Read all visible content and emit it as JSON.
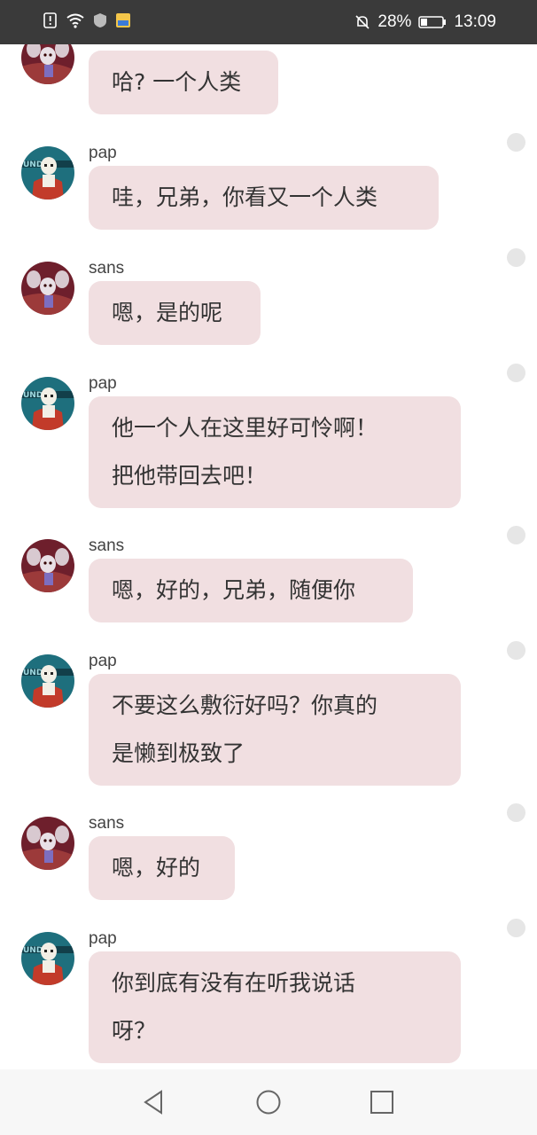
{
  "status_bar": {
    "battery": "28%",
    "time": "13:09",
    "icons": [
      "alert-icon",
      "wifi-icon",
      "shield-icon",
      "app-badge-icon",
      "mute-bell-icon",
      "battery-icon"
    ]
  },
  "messages": [
    {
      "sender": "",
      "avatar": "sans",
      "lines": [
        "哈? 一个人类"
      ]
    },
    {
      "sender": "pap",
      "avatar": "pap",
      "lines": [
        "哇，兄弟，你看又一个人类"
      ]
    },
    {
      "sender": "sans",
      "avatar": "sans",
      "lines": [
        "嗯，是的呢"
      ]
    },
    {
      "sender": "pap",
      "avatar": "pap",
      "lines": [
        "他一个人在这里好可怜啊！",
        "把他带回去吧！"
      ]
    },
    {
      "sender": "sans",
      "avatar": "sans",
      "lines": [
        "嗯，好的，兄弟，随便你"
      ]
    },
    {
      "sender": "pap",
      "avatar": "pap",
      "lines": [
        "不要这么敷衍好吗？你真的",
        "是懒到极致了"
      ]
    },
    {
      "sender": "sans",
      "avatar": "sans",
      "lines": [
        "嗯，好的"
      ]
    },
    {
      "sender": "pap",
      "avatar": "pap",
      "lines": [
        "你到底有没有在听我说话",
        "呀？"
      ]
    }
  ],
  "navigation": {
    "back_icon": "back-triangle-icon",
    "home_icon": "home-circle-icon",
    "recents_icon": "recents-square-icon"
  },
  "colors": {
    "bubble": "#f1dfe1",
    "status_bar": "#3a3a3a",
    "nav_bar": "#f7f7f7",
    "dot": "#e6e6e6"
  }
}
